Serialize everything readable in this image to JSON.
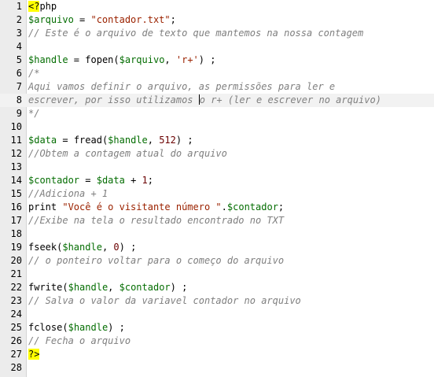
{
  "editor": {
    "current_line": 8,
    "lines": [
      {
        "n": "1",
        "tokens": [
          {
            "t": "<?",
            "c": "tag"
          },
          {
            "t": "php",
            "c": "kw"
          }
        ]
      },
      {
        "n": "2",
        "tokens": [
          {
            "t": "$arquivo",
            "c": "var"
          },
          {
            "t": " = ",
            "c": "op"
          },
          {
            "t": "\"contador.txt\"",
            "c": "str"
          },
          {
            "t": ";",
            "c": "op"
          }
        ]
      },
      {
        "n": "3",
        "tokens": [
          {
            "t": "// Este é o arquivo de texto que mantemos na nossa contagem",
            "c": "cmt"
          }
        ]
      },
      {
        "n": "4",
        "tokens": []
      },
      {
        "n": "5",
        "tokens": [
          {
            "t": "$handle",
            "c": "var"
          },
          {
            "t": " = ",
            "c": "op"
          },
          {
            "t": "fopen",
            "c": "fn"
          },
          {
            "t": "(",
            "c": "op"
          },
          {
            "t": "$arquivo",
            "c": "var"
          },
          {
            "t": ", ",
            "c": "op"
          },
          {
            "t": "'r+'",
            "c": "str"
          },
          {
            "t": ") ;",
            "c": "op"
          }
        ]
      },
      {
        "n": "6",
        "tokens": [
          {
            "t": "/*",
            "c": "cmt"
          }
        ]
      },
      {
        "n": "7",
        "tokens": [
          {
            "t": "Aqui vamos definir o arquivo, as permissões para ler e",
            "c": "cmt"
          }
        ]
      },
      {
        "n": "8",
        "tokens": [
          {
            "t": "escrever, por isso utilizamos ",
            "c": "cmt"
          },
          {
            "t": "",
            "c": "caret"
          },
          {
            "t": "o r+ (ler e escrever no arquivo)",
            "c": "cmt"
          }
        ]
      },
      {
        "n": "9",
        "tokens": [
          {
            "t": "*/",
            "c": "cmt"
          }
        ]
      },
      {
        "n": "10",
        "tokens": []
      },
      {
        "n": "11",
        "tokens": [
          {
            "t": "$data",
            "c": "var"
          },
          {
            "t": " = ",
            "c": "op"
          },
          {
            "t": "fread",
            "c": "fn"
          },
          {
            "t": "(",
            "c": "op"
          },
          {
            "t": "$handle",
            "c": "var"
          },
          {
            "t": ", ",
            "c": "op"
          },
          {
            "t": "512",
            "c": "num"
          },
          {
            "t": ") ;",
            "c": "op"
          }
        ]
      },
      {
        "n": "12",
        "tokens": [
          {
            "t": "//Obtem a contagem atual do arquivo",
            "c": "cmt"
          }
        ]
      },
      {
        "n": "13",
        "tokens": []
      },
      {
        "n": "14",
        "tokens": [
          {
            "t": "$contador",
            "c": "var"
          },
          {
            "t": " = ",
            "c": "op"
          },
          {
            "t": "$data",
            "c": "var"
          },
          {
            "t": " + ",
            "c": "op"
          },
          {
            "t": "1",
            "c": "num"
          },
          {
            "t": ";",
            "c": "op"
          }
        ]
      },
      {
        "n": "15",
        "tokens": [
          {
            "t": "//Adiciona + 1",
            "c": "cmt"
          }
        ]
      },
      {
        "n": "16",
        "tokens": [
          {
            "t": "print",
            "c": "kw"
          },
          {
            "t": " ",
            "c": "op"
          },
          {
            "t": "\"Você é o visitante número \"",
            "c": "str"
          },
          {
            "t": ".",
            "c": "op"
          },
          {
            "t": "$contador",
            "c": "var"
          },
          {
            "t": ";",
            "c": "op"
          }
        ]
      },
      {
        "n": "17",
        "tokens": [
          {
            "t": "//Exibe na tela o resultado encontrado no TXT",
            "c": "cmt"
          }
        ]
      },
      {
        "n": "18",
        "tokens": []
      },
      {
        "n": "19",
        "tokens": [
          {
            "t": "fseek",
            "c": "fn"
          },
          {
            "t": "(",
            "c": "op"
          },
          {
            "t": "$handle",
            "c": "var"
          },
          {
            "t": ", ",
            "c": "op"
          },
          {
            "t": "0",
            "c": "num"
          },
          {
            "t": ") ;",
            "c": "op"
          }
        ]
      },
      {
        "n": "20",
        "tokens": [
          {
            "t": "// o ponteiro voltar para o começo do arquivo",
            "c": "cmt"
          }
        ]
      },
      {
        "n": "21",
        "tokens": []
      },
      {
        "n": "22",
        "tokens": [
          {
            "t": "fwrite",
            "c": "fn"
          },
          {
            "t": "(",
            "c": "op"
          },
          {
            "t": "$handle",
            "c": "var"
          },
          {
            "t": ", ",
            "c": "op"
          },
          {
            "t": "$contador",
            "c": "var"
          },
          {
            "t": ") ;",
            "c": "op"
          }
        ]
      },
      {
        "n": "23",
        "tokens": [
          {
            "t": "// Salva o valor da variavel contador no arquivo",
            "c": "cmt"
          }
        ]
      },
      {
        "n": "24",
        "tokens": []
      },
      {
        "n": "25",
        "tokens": [
          {
            "t": "fclose",
            "c": "fn"
          },
          {
            "t": "(",
            "c": "op"
          },
          {
            "t": "$handle",
            "c": "var"
          },
          {
            "t": ") ;",
            "c": "op"
          }
        ]
      },
      {
        "n": "26",
        "tokens": [
          {
            "t": "// Fecha o arquivo",
            "c": "cmt"
          }
        ]
      },
      {
        "n": "27",
        "tokens": [
          {
            "t": "?>",
            "c": "tag"
          }
        ]
      },
      {
        "n": "28",
        "tokens": []
      }
    ]
  },
  "colors": {
    "variable": "#046d02",
    "string": "#9b2200",
    "number": "#6b0000",
    "comment": "#7f7f7f",
    "php_tag_highlight": "#ffff00"
  }
}
